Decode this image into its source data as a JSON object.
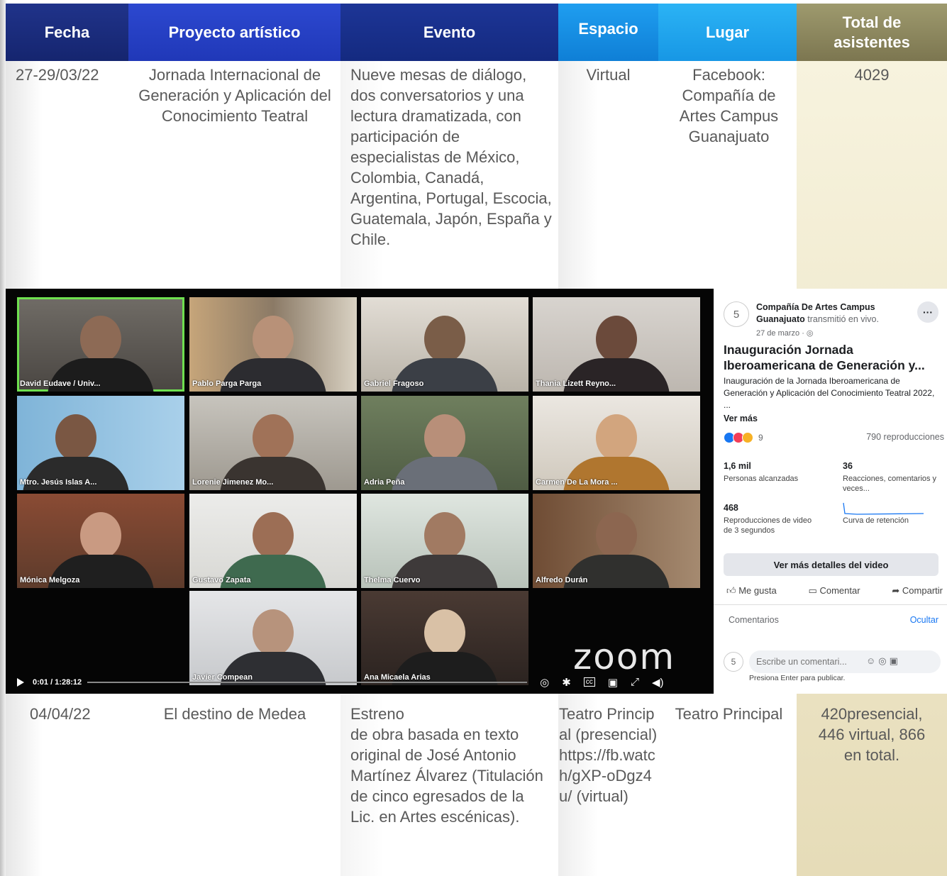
{
  "header": {
    "fecha": "Fecha",
    "proyecto": "Proyecto artístico",
    "evento": "Evento",
    "espacio": "Espacio",
    "lugar": "Lugar",
    "total": "Total de asistentes"
  },
  "row1": {
    "fecha": "27-29/03/22",
    "proyecto": "Jornada Internacional de Generación y Aplicación del Conocimiento Teatral",
    "evento": "Nueve  mesas de diálogo, dos conversatorios y una lectura dramatizada, con participación de especialistas de México, Colombia, Canadá, Argentina, Portugal, Escocia, Guatemala, Japón, España y Chile.",
    "espacio": "Virtual",
    "lugar": "Facebook: Compañía de Artes Campus Guanajuato",
    "total": "4029"
  },
  "row2": {
    "fecha": "04/04/22",
    "proyecto": "El destino de Medea",
    "evento_line1": "Estreno",
    "evento_rest": "de obra basada en texto original de José Antonio Martínez Álvarez (Titulación de cinco egresados de la Lic. en Artes escénicas).",
    "espacio": "Teatro Principal (presencial) https://fb.watch/gXP-oDgz4u/ (virtual)",
    "lugar": "Teatro Principal",
    "total": "420presencial, 446 virtual, 866 en total."
  },
  "video": {
    "participants": [
      "David Eudave / Univ...",
      "Pablo Parga Parga",
      "Gabriel Fragoso",
      "Thania Lizett Reyno...",
      "Mtro. Jesús Islas A...",
      "Lorenie Jimenez Mo...",
      "Adria Peña",
      "Carmen De La Mora ...",
      "Mónica Melgoza",
      "Gustavo Zapata",
      "Thelma Cuervo",
      "Alfredo Durán",
      "Javier Compean",
      "Ana Micaela Arias"
    ],
    "zoom_logo": "zoom",
    "time": "0:01 / 1:28:12"
  },
  "facebook": {
    "page_name": "Compañía De Artes Campus Guanajuato",
    "transmitted": "transmitió en vivo.",
    "date": "27 de marzo · ◎",
    "title": "Inauguración Jornada Iberoamericana de Generación y...",
    "description": "Inauguración de la Jornada Iberoamericana de Generación y Aplicación del Conocimiento Teatral 2022, ...",
    "see_more": "Ver más",
    "reaction_count": "9",
    "views": "790 reproducciones",
    "reached_num": "1,6 mil",
    "reached_lbl": "Personas alcanzadas",
    "reactions_num": "36",
    "reactions_lbl": "Reacciones, comentarios y veces...",
    "plays_num": "468",
    "plays_lbl": "Reproducciones de video de 3 segundos",
    "retention_lbl": "Curva de retención",
    "details_button": "Ver más detalles del video",
    "like": "Me gusta",
    "comment": "Comentar",
    "share": "Compartir",
    "comments_label": "Comentarios",
    "hide": "Ocultar",
    "comment_placeholder": "Escribe un comentari...",
    "enter_hint": "Presiona Enter para publicar."
  }
}
